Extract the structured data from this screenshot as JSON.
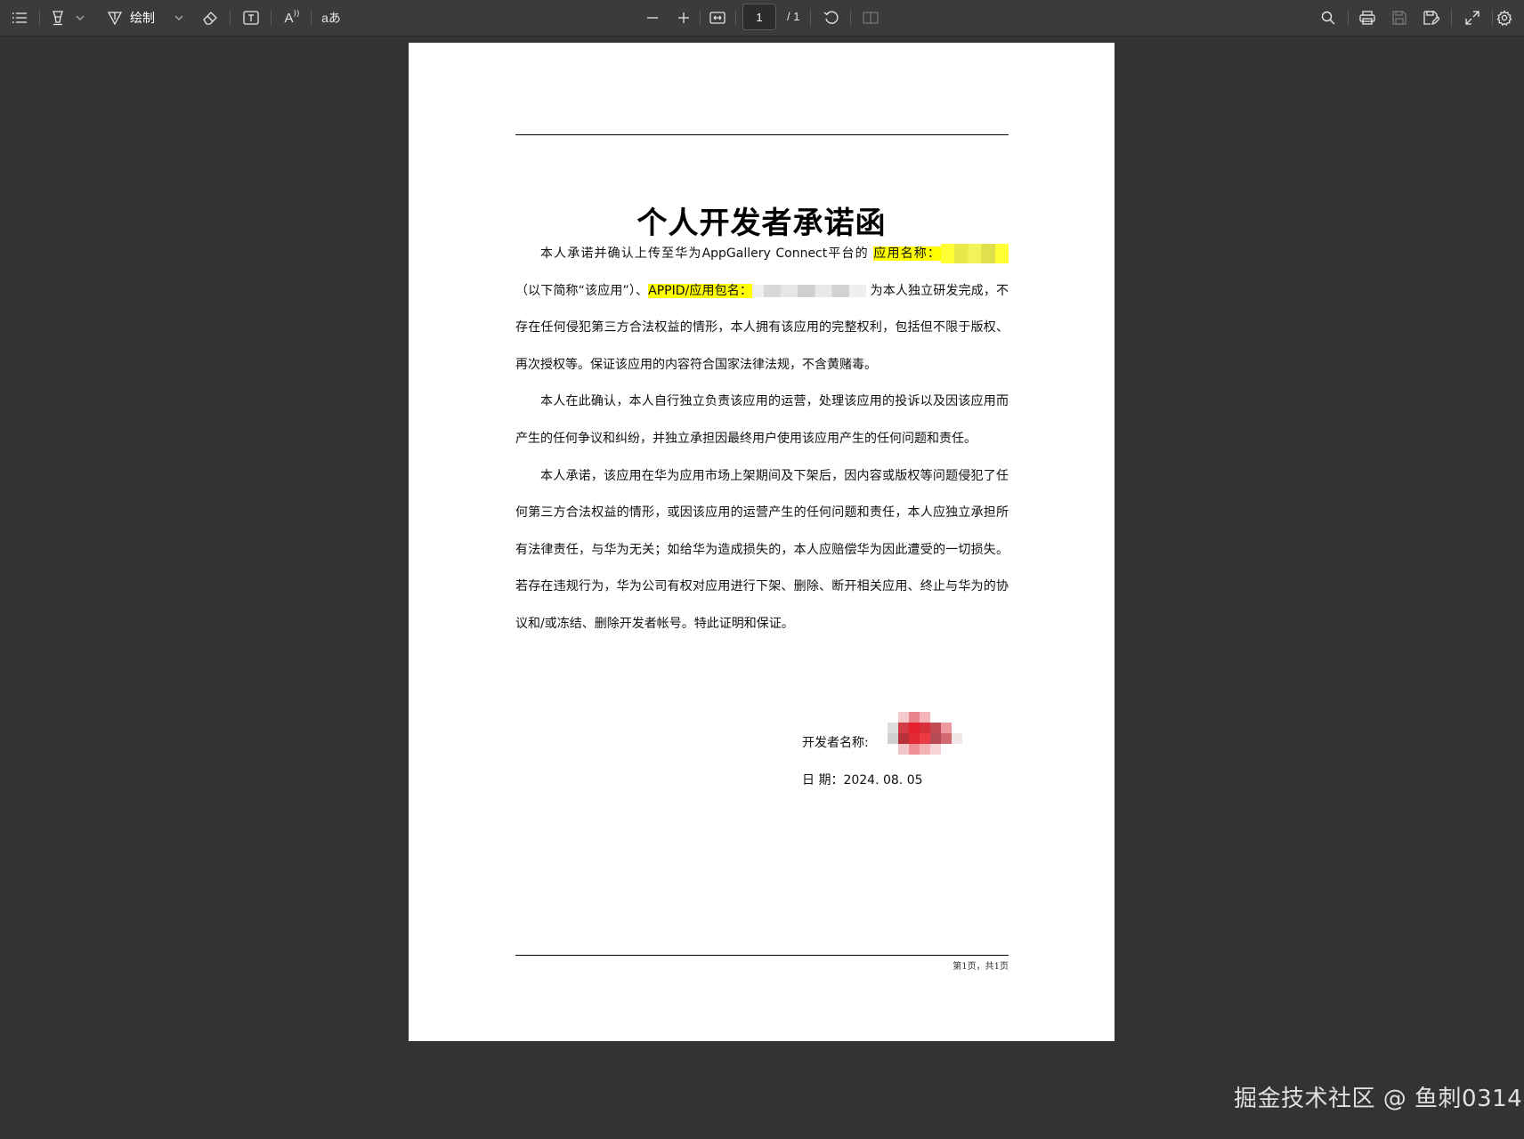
{
  "toolbar": {
    "draw_label": "绘制",
    "current_page": "1",
    "page_total": "/ 1",
    "read_aloud_glyph": "A",
    "translate_glyph": "aあ",
    "icons": [
      "list-icon",
      "highlighter-icon",
      "chevron-down-icon",
      "pen-icon",
      "chevron-down-icon",
      "eraser-icon",
      "textbox-icon",
      "read-aloud-icon",
      "translate-icon",
      "zoom-out-icon",
      "zoom-in-icon",
      "fit-width-icon",
      "rotate-icon",
      "two-page-icon",
      "search-icon",
      "print-icon",
      "save-icon",
      "save-as-icon",
      "fullscreen-icon",
      "settings-icon"
    ]
  },
  "document": {
    "title": "个人开发者承诺函",
    "p1_a": "本人承诺并确认上传至华为AppGallery Connect平台的 ",
    "p1_app_name_label": "应用名称：",
    "p1_b": " （以下简称“该应用”）、",
    "p1_appid_label": "APPID/应用包名：",
    "p1_c": " 为本人独立研发完成，不存在任何侵犯第三方合法权益的情形，本人拥有该应用的完整权利，包括但不限于版权、再次授权等。保证该应用的内容符合国家法律法规，不含黄赌毒。",
    "p2": "本人在此确认，本人自行独立负责该应用的运营，处理该应用的投诉以及因该应用而产生的任何争议和纠纷，并独立承担因最终用户使用该应用产生的任何问题和责任。",
    "p3": "本人承诺，该应用在华为应用市场上架期间及下架后，因内容或版权等问题侵犯了任何第三方合法权益的情形，或因该应用的运营产生的任何问题和责任，本人应独立承担所有法律责任，与华为无关；如给华为造成损失的，本人应赔偿华为因此遭受的一切损失。若存在违规行为，华为公司有权对应用进行下架、删除、断开相关应用、终止与华为的协议和/或冻结、删除开发者帐号。特此证明和保证。",
    "developer_label": "开发者名称:",
    "date_label": "日 期：2024. 08. 05",
    "footer": "第1页，共1页"
  },
  "watermark": "掘金技术社区 @ 鱼刺0314",
  "colors": {
    "background": "#333333",
    "toolbar": "#3b3b3b",
    "highlight": "#ffff00"
  }
}
